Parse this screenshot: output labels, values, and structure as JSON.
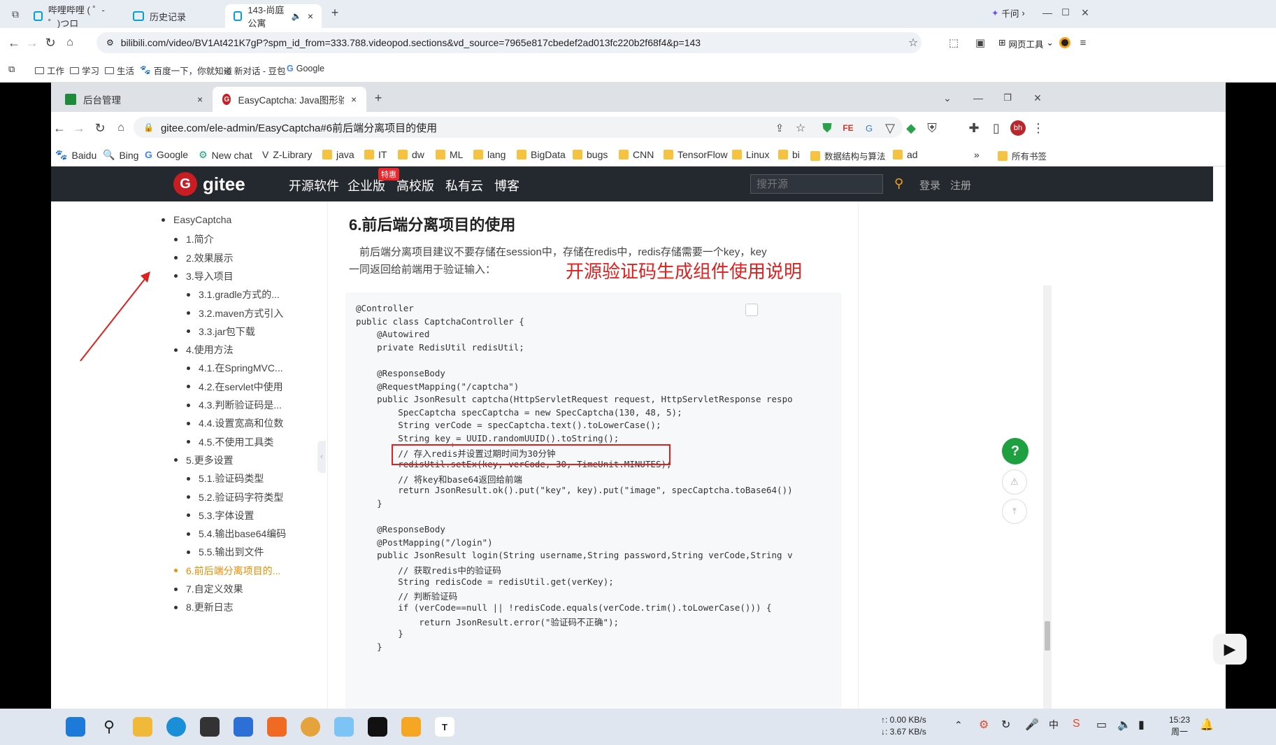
{
  "outer_browser": {
    "tabs": [
      {
        "label": "哔哩哔哩 ( ゜- ゜)つロ"
      },
      {
        "label": "历史记录"
      },
      {
        "label": "143-尚庭公寓"
      }
    ],
    "right_label": "千问",
    "url": "bilibili.com/video/BV1At421K7gP?spm_id_from=333.788.videopod.sections&vd_source=7965e817cbedef2ad013fc220b2f68f4&p=143",
    "tools_label": "网页工具",
    "bookmarks": [
      "工作",
      "学习",
      "生活",
      "百度一下，你就知道",
      "新对话 - 豆包",
      "Google"
    ]
  },
  "inner_browser": {
    "tabs": [
      {
        "label": "后台管理"
      },
      {
        "label": "EasyCaptcha: Java图形验证码..."
      }
    ],
    "url": "gitee.com/ele-admin/EasyCaptcha#6前后端分离项目的使用",
    "bookmarks": [
      "Baidu",
      "Bing",
      "Google",
      "New chat",
      "Z-Library",
      "java",
      "IT",
      "dw",
      "ML",
      "lang",
      "BigData",
      "bugs",
      "CNN",
      "TensorFlow",
      "Linux",
      "bi",
      "数据结构与算法",
      "ad"
    ],
    "all_bookmarks": "所有书签",
    "more": "»"
  },
  "gitee": {
    "logo": "gitee",
    "nav": [
      "开源软件",
      "企业版",
      "高校版",
      "私有云",
      "博客"
    ],
    "badge": "特惠",
    "search_placeholder": "搜开源",
    "login": "登录",
    "register": "注册"
  },
  "toc": [
    {
      "label": "EasyCaptcha",
      "level": 0
    },
    {
      "label": "1.简介",
      "level": 1
    },
    {
      "label": "2.效果展示",
      "level": 1
    },
    {
      "label": "3.导入项目",
      "level": 1
    },
    {
      "label": "3.1.gradle方式的...",
      "level": 2
    },
    {
      "label": "3.2.maven方式引入",
      "level": 2
    },
    {
      "label": "3.3.jar包下载",
      "level": 2
    },
    {
      "label": "4.使用方法",
      "level": 1
    },
    {
      "label": "4.1.在SpringMVC...",
      "level": 2
    },
    {
      "label": "4.2.在servlet中使用",
      "level": 2
    },
    {
      "label": "4.3.判断验证码是...",
      "level": 2
    },
    {
      "label": "4.4.设置宽高和位数",
      "level": 2
    },
    {
      "label": "4.5.不使用工具类",
      "level": 2
    },
    {
      "label": "5.更多设置",
      "level": 1
    },
    {
      "label": "5.1.验证码类型",
      "level": 2
    },
    {
      "label": "5.2.验证码字符类型",
      "level": 2
    },
    {
      "label": "5.3.字体设置",
      "level": 2
    },
    {
      "label": "5.4.输出base64编码",
      "level": 2
    },
    {
      "label": "5.5.输出到文件",
      "level": 2
    },
    {
      "label": "6.前后端分离项目的...",
      "level": 1,
      "active": true
    },
    {
      "label": "7.自定义效果",
      "level": 1
    },
    {
      "label": "8.更新日志",
      "level": 1
    }
  ],
  "content": {
    "heading": "6.前后端分离项目的使用",
    "para_line1": "前后端分离项目建议不要存储在session中，存储在redis中，redis存储需要一个key，key",
    "para_line2": "一同返回给前端用于验证输入：",
    "overlay_title": "开源验证码生成组件使用说明"
  },
  "code_lines": [
    "@Controller",
    "public class CaptchaController {",
    "    @Autowired",
    "    private RedisUtil redisUtil;",
    "",
    "    @ResponseBody",
    "    @RequestMapping(\"/captcha\")",
    "    public JsonResult captcha(HttpServletRequest request, HttpServletResponse respo",
    "        SpecCaptcha specCaptcha = new SpecCaptcha(130, 48, 5);",
    "        String verCode = specCaptcha.text().toLowerCase();",
    "        String key = UUID.randomUUID().toString();",
    "        // 存入redis并设置过期时间为30分钟",
    "        redisUtil.setEx(key, verCode, 30, TimeUnit.MINUTES);",
    "        // 将key和base64返回给前端",
    "        return JsonResult.ok().put(\"key\", key).put(\"image\", specCaptcha.toBase64())",
    "    }",
    "",
    "    @ResponseBody",
    "    @PostMapping(\"/login\")",
    "    public JsonResult login(String username,String password,String verCode,String v",
    "        // 获取redis中的验证码",
    "        String redisCode = redisUtil.get(verKey);",
    "        // 判断验证码",
    "        if (verCode==null || !redisCode.equals(verCode.trim().toLowerCase())) {",
    "            return JsonResult.error(\"验证码不正确\");",
    "        }",
    "    }"
  ],
  "float_buttons": {
    "help": "?"
  },
  "taskbar": {
    "net_up": "↑: 0.00 KB/s",
    "net_down": "↓: 3.67 KB/s",
    "time": "15:23",
    "day": "周一"
  },
  "colors": {
    "gitee_red": "#c71d23",
    "annotation_red": "#e0201e",
    "toc_active": "#f08c00",
    "help_green": "#1fa040"
  }
}
